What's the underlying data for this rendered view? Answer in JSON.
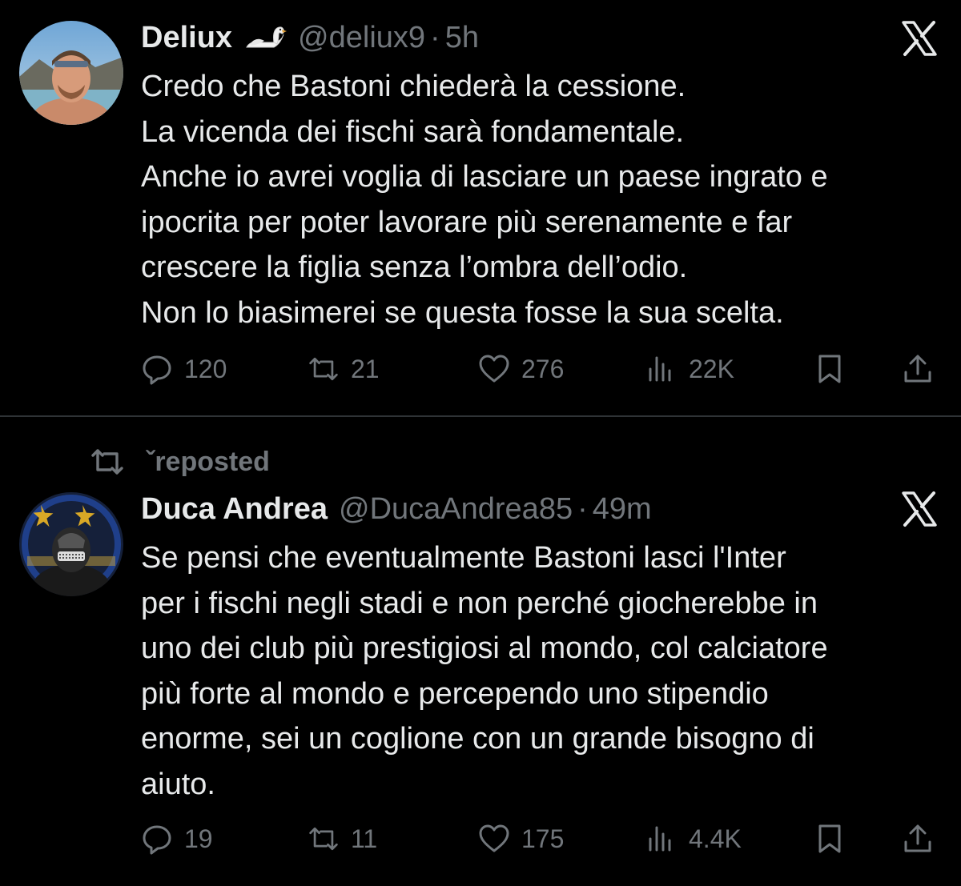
{
  "tweets": [
    {
      "author_name": "Deliux",
      "badge_icon": "swan-emoji",
      "handle": "@deliux9",
      "separator": "·",
      "time": "5h",
      "lines": [
        "Credo che Bastoni chiederà la cessione.",
        "La vicenda dei fischi sarà fondamentale.",
        "Anche io avrei voglia di lasciare un paese ingrato e",
        "ipocrita per poter lavorare più serenamente e far",
        "crescere la figlia senza l’ombra dell’odio.",
        "Non lo biasimerei se questa fosse la sua scelta."
      ],
      "replies": "120",
      "reposts": "21",
      "likes": "276",
      "views": "22K"
    },
    {
      "author_name": "Duca Andrea",
      "handle": "@DucaAndrea85",
      "separator": "·",
      "time": "49m",
      "lines": [
        "Se pensi che eventualmente Bastoni lasci l'Inter",
        "per i fischi negli stadi e non perché giocherebbe in",
        "uno dei club più prestigiosi al mondo, col calciatore",
        "più forte al mondo e percependo uno stipendio",
        "enorme, sei un coglione con un grande bisogno di",
        "aiuto."
      ],
      "replies": "19",
      "reposts": "11",
      "likes": "175",
      "views": "4.4K"
    }
  ],
  "repost_banner": {
    "label": "ˇreposted"
  },
  "colors": {
    "background": "#000000",
    "text": "#e7e9ea",
    "muted": "#71767b",
    "divider": "#2f3336"
  },
  "icons": {
    "reply": "reply-icon",
    "repost": "repost-icon",
    "like": "heart-icon",
    "views": "views-icon",
    "bookmark": "bookmark-icon",
    "share": "share-icon",
    "x_logo": "x-logo-icon"
  }
}
